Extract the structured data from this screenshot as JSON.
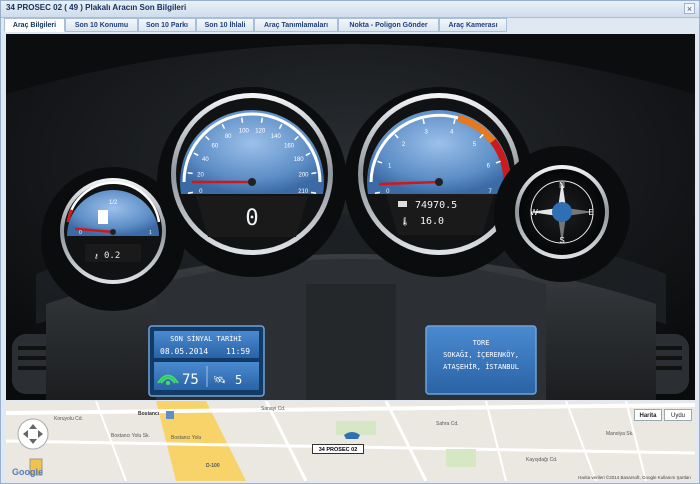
{
  "window": {
    "title": "34 PROSEC 02 ( 49 ) Plakalı Aracın Son Bilgileri"
  },
  "tabs": [
    {
      "label": "Araç Bilgileri",
      "active": true
    },
    {
      "label": "Son 10 Konumu"
    },
    {
      "label": "Son 10 Parkı"
    },
    {
      "label": "Son 10 İhlali"
    },
    {
      "label": "Araç Tanımlamaları"
    },
    {
      "label": "Nokta - Poligon Gönder"
    },
    {
      "label": "Araç Kamerası"
    }
  ],
  "fuel_gauge": {
    "label_top": "1/2",
    "label_left": "0",
    "label_right": "1",
    "readout": "0.2",
    "needle_fraction": 0.0
  },
  "speedometer": {
    "ticks": [
      "0",
      "20",
      "40",
      "60",
      "80",
      "100",
      "120",
      "140",
      "160",
      "180",
      "200",
      "210"
    ],
    "speed_value": "0",
    "needle_fraction": 0.05
  },
  "tachometer": {
    "ticks": [
      "0",
      "1",
      "2",
      "3",
      "4",
      "5",
      "6",
      "7"
    ],
    "odometer": "74970.5",
    "temperature": "16.0",
    "needle_fraction": 0.04
  },
  "compass": {
    "n": "N",
    "e": "E",
    "s": "S",
    "w": "W"
  },
  "signal_panel": {
    "title": "SON SİNYAL TARİHİ",
    "date": "08.05.2014",
    "time": "11:59",
    "signal": "75",
    "satellite": "5"
  },
  "address_panel": {
    "lines": [
      "TORE",
      "SOKAĞI, İÇERENKÖY,",
      "ATAŞEHİR, İSTANBUL"
    ]
  },
  "map": {
    "type_buttons": [
      "Harita",
      "Uydu"
    ],
    "active_type": "Harita",
    "plate_label": "34 PROSEC 02",
    "google_logo": "Google",
    "attribution": "Harita verileri ©2014 Basarsoft, Google   Kullanım Şartları",
    "street_labels": [
      "Koruyolu Cd.",
      "Bostancı",
      "Bostancı Yolu Sk.",
      "Sanayi Cd.",
      "Bostancı Yolu",
      "D-100",
      "Sahra Cd.",
      "Kayışdağı Cd.",
      "Manolya Sk."
    ]
  },
  "colors": {
    "gauge_face": "#5d8ec6",
    "lcd_bg": "#1a1a1a",
    "panel_blue": "#2f6fb4",
    "redline": "#cc1b1b",
    "orange_zone": "#e8781e"
  }
}
